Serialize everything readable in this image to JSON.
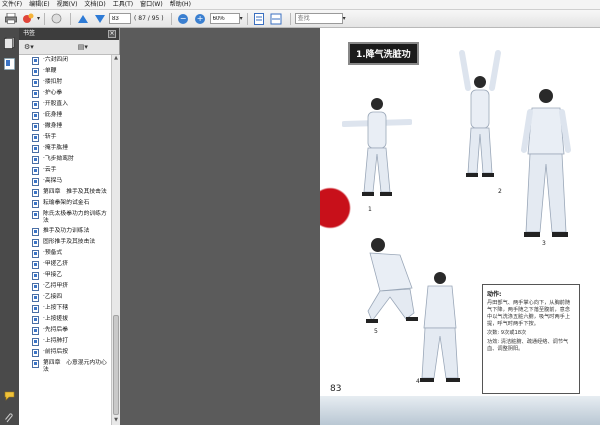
{
  "menu": [
    "文件(F)",
    "编辑(E)",
    "视图(V)",
    "文档(D)",
    "工具(T)",
    "窗口(W)",
    "帮助(H)"
  ],
  "toolbar": {
    "page_current": "83",
    "page_total": "( 87 / 95 )",
    "zoom": "60%",
    "search_placeholder": "查找"
  },
  "panel": {
    "title": "书签",
    "close": "×"
  },
  "bookmarks": [
    "·六封四闭",
    "·单鞭",
    "·搂扣肘",
    "·护心拳",
    "·开股直入",
    "·庇身捶",
    "·撇身捶",
    "·斩手",
    "·掩手肱捶",
    "·飞步拗鸾肘",
    "·云手",
    "·高探马",
    "第四章　推手及其技击法",
    "耘瑜拳架的试金石",
    "陈氏太极拳功力的训练方法",
    "推手及功力训练法",
    "固形推手及其技击法",
    "·预备式",
    "·甲搓乙挤",
    "·甲接乙",
    "·乙捋甲挤",
    "·乙接四",
    "·上按下辖",
    "·上按搓拔",
    "·先捋后拳",
    "·上捋肺打",
    "·前捋后按",
    "第四章　心意混元内功心法"
  ],
  "page": {
    "title": "1.降气洗脏功",
    "figure_numbers": [
      "1",
      "2",
      "3",
      "4",
      "5"
    ],
    "box_heading": "动作:",
    "box_text": "丹田部气、两手掌心向下，从胸前随气下降，两手随之下落至腹前，意念中以气洗涤五脏六腑，吸气时两手上提，呼气时两手下按。",
    "box_count": "次数: 9次或18次",
    "box_effect": "功效: 清洁脏腑、疏通经络、调节气血、调整阴阳。",
    "page_number": "83"
  },
  "colors": {
    "accent_blue": "#2e7bd6",
    "brush_red": "#c8101a",
    "panel_dark": "#3d3d3d"
  }
}
